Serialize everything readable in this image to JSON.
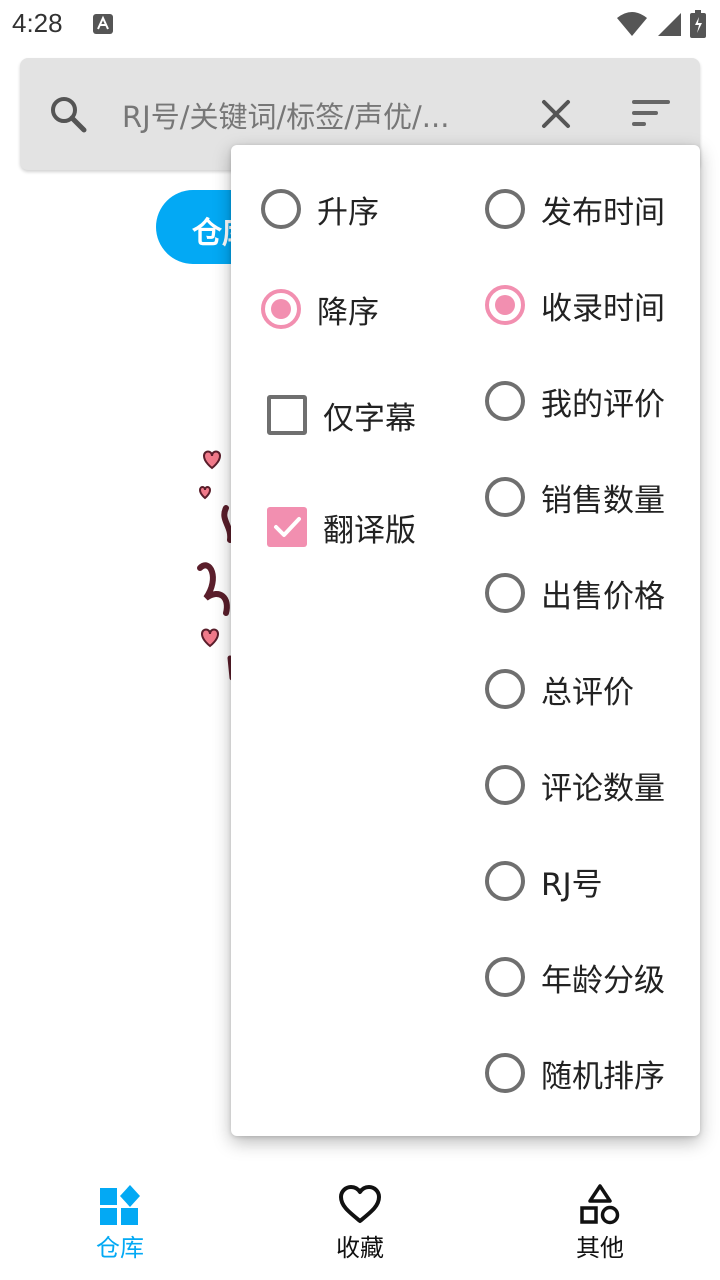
{
  "status_bar": {
    "time": "4:28"
  },
  "search": {
    "placeholder": "RJ号/关键词/标签/声优/..."
  },
  "background_tab": {
    "label": "仓库"
  },
  "sort_menu": {
    "order_options": [
      {
        "label": "升序",
        "selected": false
      },
      {
        "label": "降序",
        "selected": true
      }
    ],
    "filters": [
      {
        "label": "仅字幕",
        "checked": false
      },
      {
        "label": "翻译版",
        "checked": true
      }
    ],
    "sort_fields": [
      {
        "label": "发布时间",
        "selected": false
      },
      {
        "label": "收录时间",
        "selected": true
      },
      {
        "label": "我的评价",
        "selected": false
      },
      {
        "label": "销售数量",
        "selected": false
      },
      {
        "label": "出售价格",
        "selected": false
      },
      {
        "label": "总评价",
        "selected": false
      },
      {
        "label": "评论数量",
        "selected": false
      },
      {
        "label": "RJ号",
        "selected": false
      },
      {
        "label": "年龄分级",
        "selected": false
      },
      {
        "label": "随机排序",
        "selected": false
      }
    ]
  },
  "bottom_nav": {
    "items": [
      {
        "label": "仓库",
        "icon": "grid-diamond-icon",
        "active": true
      },
      {
        "label": "收藏",
        "icon": "heart-icon",
        "active": false
      },
      {
        "label": "其他",
        "icon": "shapes-icon",
        "active": false
      }
    ]
  },
  "colors": {
    "accent": "#03a9f4",
    "selection": "#f28fb0"
  }
}
